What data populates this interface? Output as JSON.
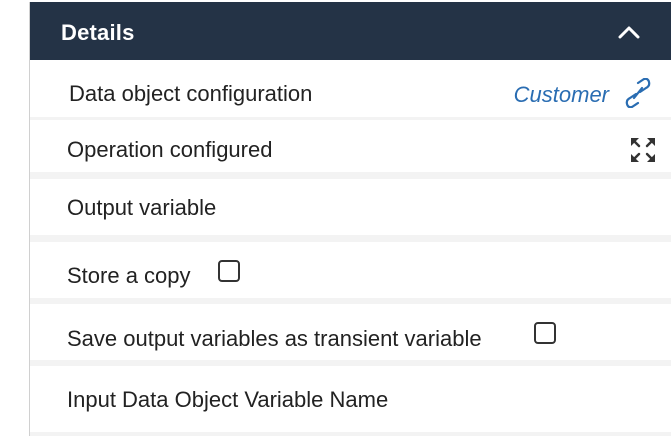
{
  "panel": {
    "title": "Details",
    "collapse_icon": "chevron-up-icon"
  },
  "rows": {
    "data_object": {
      "label": "Data object configuration",
      "value": "Customer",
      "icon": "link-icon"
    },
    "operation": {
      "label": "Operation configured",
      "icon": "expand-icon"
    },
    "output_variable": {
      "label": "Output variable"
    },
    "store_copy": {
      "label": "Store a copy",
      "checked": false
    },
    "transient": {
      "label": "Save output variables as transient variable",
      "checked": false
    },
    "input_name": {
      "label": "Input Data Object Variable Name"
    }
  },
  "colors": {
    "header_bg": "#243346",
    "link": "#2a6db2",
    "separator": "#f3f3f3"
  }
}
